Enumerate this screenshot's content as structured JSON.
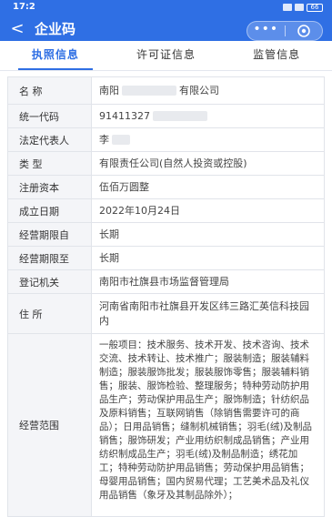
{
  "status_bar": {
    "time": "17:2",
    "battery": "66"
  },
  "header": {
    "back": "<",
    "title": "企业码",
    "more": "•••"
  },
  "tabs": [
    {
      "label": "执照信息",
      "active": true
    },
    {
      "label": "许可证信息",
      "active": false
    },
    {
      "label": "监管信息",
      "active": false
    }
  ],
  "fields": [
    {
      "label": "名 称",
      "value_prefix": "南阳",
      "value_suffix": "有限公司"
    },
    {
      "label": "统一代码",
      "value": "91411327"
    },
    {
      "label": "法定代表人",
      "value": "李"
    },
    {
      "label": "类 型",
      "value": "有限责任公司(自然人投资或控股)"
    },
    {
      "label": "注册资本",
      "value": "伍佰万圆整"
    },
    {
      "label": "成立日期",
      "value": "2022年10月24日"
    },
    {
      "label": "经营期限自",
      "value": "长期"
    },
    {
      "label": "经营期限至",
      "value": "长期"
    },
    {
      "label": "登记机关",
      "value": "南阳市社旗县市场监督管理局"
    },
    {
      "label": "住 所",
      "value": "河南省南阳市社旗县开发区纬三路汇英信科技园内"
    },
    {
      "label": "经营范围",
      "value": "一般项目：技术服务、技术开发、技术咨询、技术交流、技术转让、技术推广；服装制造；服装辅料制造；服装服饰批发；服装服饰零售；服装辅料销售；服装、服饰检验、整理服务；特种劳动防护用品生产；劳动保护用品生产；服饰制造；针纺织品及原料销售；互联网销售（除销售需要许可的商品）；日用品销售；缝制机械销售；羽毛(绒)及制品销售；服饰研发；产业用纺织制成品销售；产业用纺织制成品生产；羽毛(绒)及制品制造；绣花加工；特种劳动防护用品销售；劳动保护用品销售；母婴用品销售；国内贸易代理；工艺美术品及礼仪用品销售（象牙及其制品除外）；"
    }
  ]
}
